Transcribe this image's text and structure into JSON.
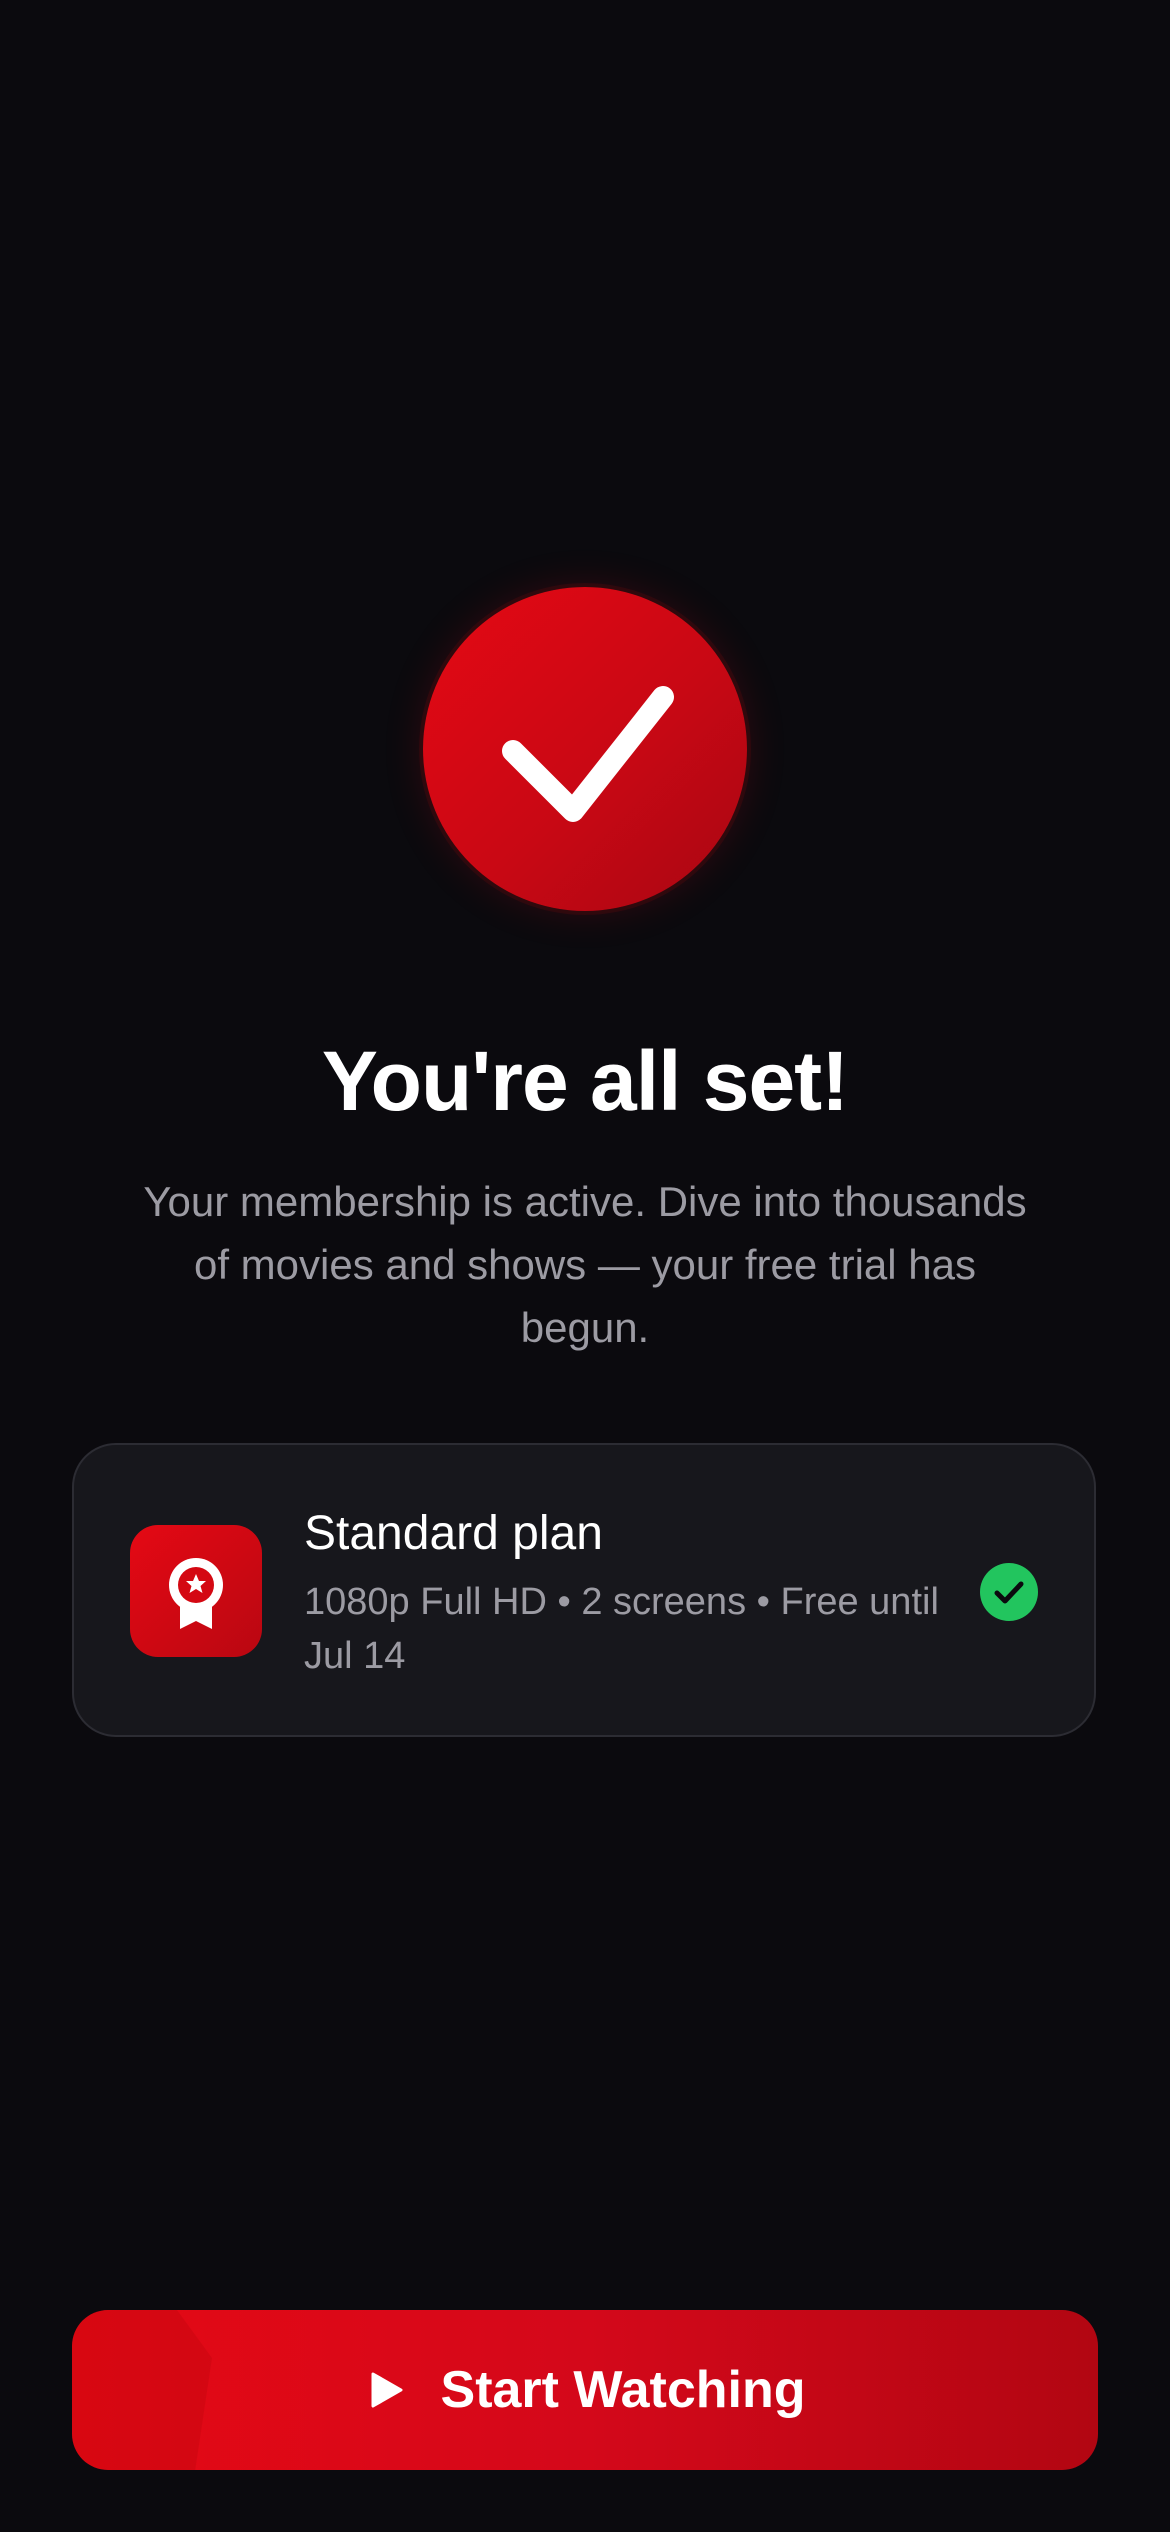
{
  "confirmation": {
    "title": "You're all set!",
    "message": "Your membership is active. Dive into thousands of movies and shows — your free trial has begun."
  },
  "plan": {
    "name": "Standard plan",
    "details": "1080p Full HD • 2 screens • Free until Jul 14",
    "icon": "award-ribbon-icon",
    "status_icon": "check-circle-icon"
  },
  "cta": {
    "label": "Start Watching",
    "icon": "play-icon"
  },
  "colors": {
    "background": "#0b0a0e",
    "accent": "#e50914",
    "card": "#17171c",
    "success": "#22c55e",
    "muted_text": "#9c9ba3"
  }
}
